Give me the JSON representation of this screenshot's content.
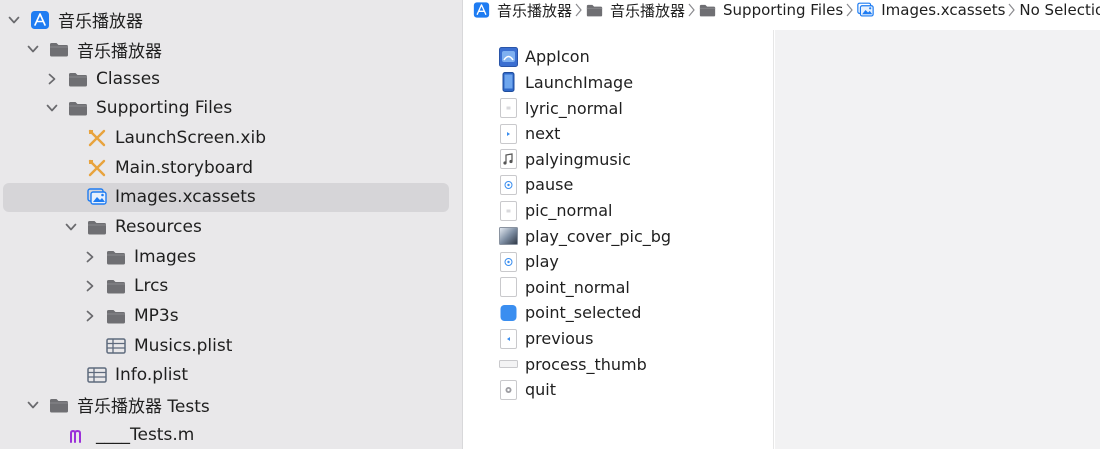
{
  "navigator": {
    "items": [
      {
        "label": "音乐播放器",
        "icon": "app-project-icon",
        "chevron": "down",
        "level": 0
      },
      {
        "label": "音乐播放器",
        "icon": "folder-icon",
        "chevron": "down",
        "level": 1
      },
      {
        "label": "Classes",
        "icon": "folder-icon",
        "chevron": "right",
        "level": 2
      },
      {
        "label": "Supporting Files",
        "icon": "folder-icon",
        "chevron": "down",
        "level": 2
      },
      {
        "label": "LaunchScreen.xib",
        "icon": "interface-builder-icon",
        "chevron": "none",
        "level": 3
      },
      {
        "label": "Main.storyboard",
        "icon": "interface-builder-icon",
        "chevron": "none",
        "level": 3
      },
      {
        "label": "Images.xcassets",
        "icon": "asset-catalog-icon",
        "chevron": "none",
        "level": 3,
        "selected": true
      },
      {
        "label": "Resources",
        "icon": "folder-icon",
        "chevron": "down",
        "level": 3
      },
      {
        "label": "Images",
        "icon": "folder-icon",
        "chevron": "right",
        "level": 4
      },
      {
        "label": "Lrcs",
        "icon": "folder-icon",
        "chevron": "right",
        "level": 4
      },
      {
        "label": "MP3s",
        "icon": "folder-icon",
        "chevron": "right",
        "level": 4
      },
      {
        "label": "Musics.plist",
        "icon": "plist-icon",
        "chevron": "none",
        "level": 4
      },
      {
        "label": "Info.plist",
        "icon": "plist-icon",
        "chevron": "none",
        "level": 3
      },
      {
        "label": "音乐播放器 Tests",
        "icon": "folder-icon",
        "chevron": "down",
        "level": 1
      },
      {
        "label": "____Tests.m",
        "icon": "objc-file-icon",
        "chevron": "none",
        "level": 2
      }
    ]
  },
  "breadcrumb": {
    "items": [
      {
        "label": "音乐播放器",
        "icon": "app-project-icon"
      },
      {
        "label": "音乐播放器",
        "icon": "folder-icon"
      },
      {
        "label": "Supporting Files",
        "icon": "folder-icon"
      },
      {
        "label": "Images.xcassets",
        "icon": "asset-catalog-icon"
      },
      {
        "label": "No Selection",
        "icon": ""
      }
    ]
  },
  "assets": {
    "items": [
      {
        "label": "AppIcon",
        "icon": "app-icon-set-icon"
      },
      {
        "label": "LaunchImage",
        "icon": "launch-image-icon"
      },
      {
        "label": "lyric_normal",
        "icon": "image-set-icon"
      },
      {
        "label": "next",
        "icon": "next-image-icon"
      },
      {
        "label": "palyingmusic",
        "icon": "music-note-icon"
      },
      {
        "label": "pause",
        "icon": "pause-image-icon"
      },
      {
        "label": "pic_normal",
        "icon": "image-set-icon"
      },
      {
        "label": "play_cover_pic_bg",
        "icon": "cover-bg-image-icon"
      },
      {
        "label": "play",
        "icon": "play-image-icon"
      },
      {
        "label": "point_normal",
        "icon": "blank-image-icon"
      },
      {
        "label": "point_selected",
        "icon": "blue-point-image-icon"
      },
      {
        "label": "previous",
        "icon": "previous-image-icon"
      },
      {
        "label": "process_thumb",
        "icon": "thumb-image-icon"
      },
      {
        "label": "quit",
        "icon": "quit-image-icon"
      }
    ]
  },
  "colors": {
    "navigator_bg": "#e9e8ea",
    "selection_bg": "#d6d5d8",
    "folder": "#6f6f73",
    "xcode_blue": "#1e7cf2",
    "ib_orange": "#e8a33d",
    "objc_purple": "#9b30d9",
    "editor_bg": "#f2f2f3"
  }
}
